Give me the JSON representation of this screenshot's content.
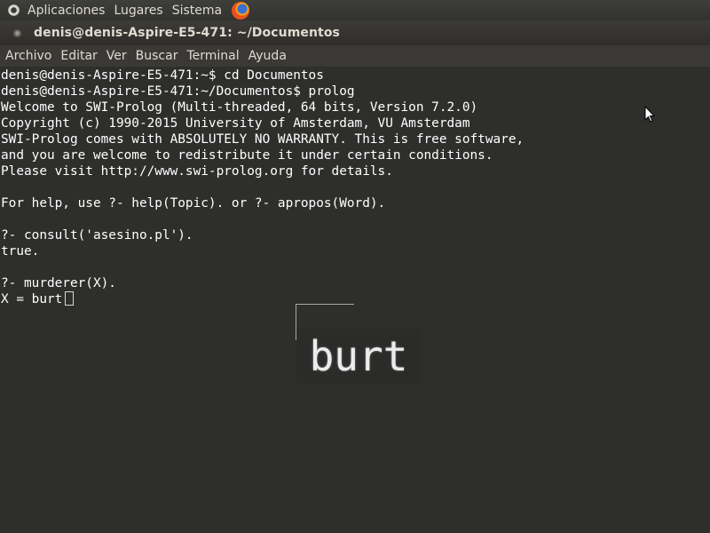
{
  "top_panel": {
    "menus": [
      "Aplicaciones",
      "Lugares",
      "Sistema"
    ]
  },
  "window": {
    "title": "denis@denis-Aspire-E5-471: ~/Documentos"
  },
  "menubar": {
    "items": [
      "Archivo",
      "Editar",
      "Ver",
      "Buscar",
      "Terminal",
      "Ayuda"
    ]
  },
  "terminal": {
    "lines": [
      "denis@denis-Aspire-E5-471:~$ cd Documentos",
      "denis@denis-Aspire-E5-471:~/Documentos$ prolog",
      "Welcome to SWI-Prolog (Multi-threaded, 64 bits, Version 7.2.0)",
      "Copyright (c) 1990-2015 University of Amsterdam, VU Amsterdam",
      "SWI-Prolog comes with ABSOLUTELY NO WARRANTY. This is free software,",
      "and you are welcome to redistribute it under certain conditions.",
      "Please visit http://www.swi-prolog.org for details.",
      "",
      "For help, use ?- help(Topic). or ?- apropos(Word).",
      "",
      "?- consult('asesino.pl').",
      "true.",
      "",
      "?- murderer(X).",
      "X = burt"
    ]
  },
  "magnifier": {
    "text": "burt"
  },
  "colors": {
    "terminal_bg": "#2e2e2c",
    "terminal_fg": "#ffffff",
    "panel_bg": "#3a3935",
    "panel_fg": "#dfdbd2"
  }
}
